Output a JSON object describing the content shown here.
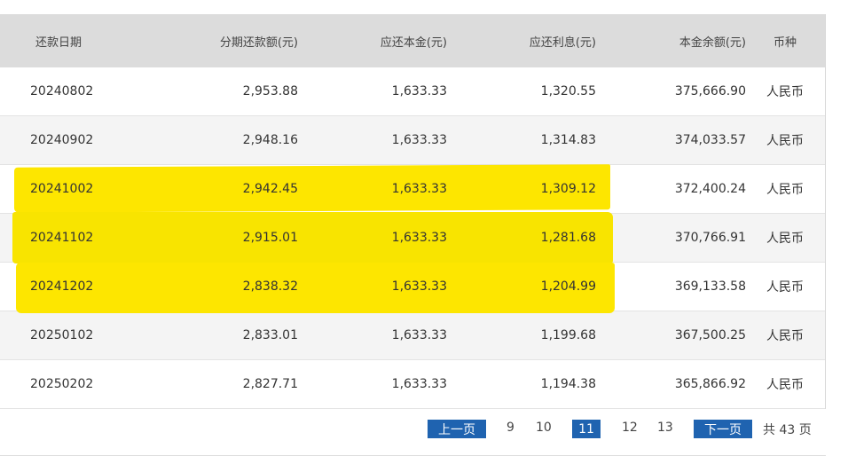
{
  "table": {
    "headers": {
      "date": "还款日期",
      "installment": "分期还款额(元)",
      "principal": "应还本金(元)",
      "interest": "应还利息(元)",
      "balance": "本金余额(元)",
      "currency": "币种"
    },
    "rows": [
      {
        "date": "20240802",
        "installment": "2,953.88",
        "principal": "1,633.33",
        "interest": "1,320.55",
        "balance": "375,666.90",
        "currency": "人民币"
      },
      {
        "date": "20240902",
        "installment": "2,948.16",
        "principal": "1,633.33",
        "interest": "1,314.83",
        "balance": "374,033.57",
        "currency": "人民币"
      },
      {
        "date": "20241002",
        "installment": "2,942.45",
        "principal": "1,633.33",
        "interest": "1,309.12",
        "balance": "372,400.24",
        "currency": "人民币"
      },
      {
        "date": "20241102",
        "installment": "2,915.01",
        "principal": "1,633.33",
        "interest": "1,281.68",
        "balance": "370,766.91",
        "currency": "人民币"
      },
      {
        "date": "20241202",
        "installment": "2,838.32",
        "principal": "1,633.33",
        "interest": "1,204.99",
        "balance": "369,133.58",
        "currency": "人民币"
      },
      {
        "date": "20250102",
        "installment": "2,833.01",
        "principal": "1,633.33",
        "interest": "1,199.68",
        "balance": "367,500.25",
        "currency": "人民币"
      },
      {
        "date": "20250202",
        "installment": "2,827.71",
        "principal": "1,633.33",
        "interest": "1,194.38",
        "balance": "365,866.92",
        "currency": "人民币"
      }
    ]
  },
  "highlight": {
    "color": "#fde600",
    "rows": [
      2,
      3,
      4
    ]
  },
  "pagination": {
    "prev_label": "上一页",
    "next_label": "下一页",
    "pages": [
      "9",
      "10",
      "11",
      "12",
      "13"
    ],
    "current": "11",
    "total_label": "共 43 页",
    "accent": "#1f63b0"
  }
}
